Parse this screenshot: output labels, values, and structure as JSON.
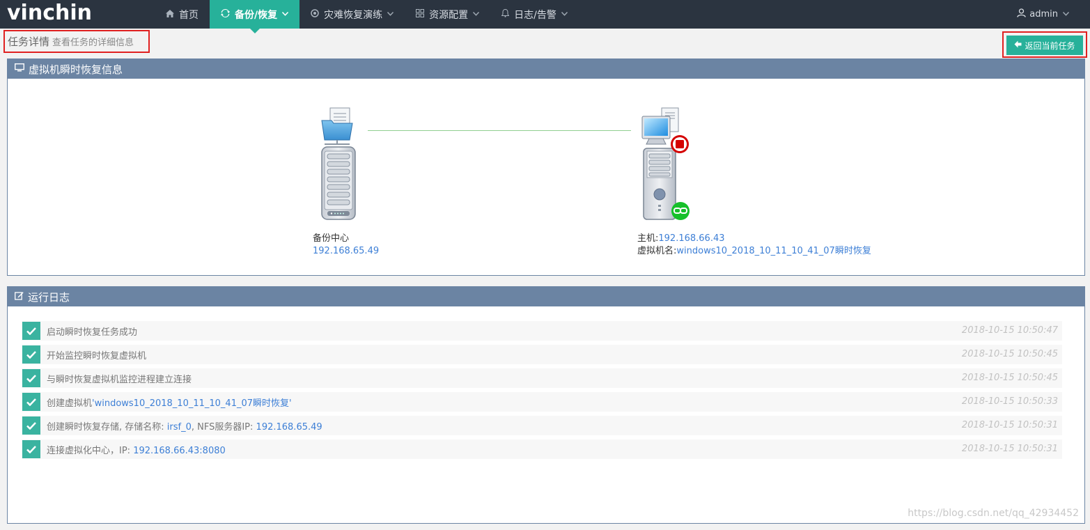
{
  "app": {
    "logo": "vinchin"
  },
  "nav": {
    "items": [
      {
        "label": "首页",
        "icon": "home-icon"
      },
      {
        "label": "备份/恢复",
        "icon": "sync-icon",
        "active": true
      },
      {
        "label": "灾难恢复演练",
        "icon": "drill-icon"
      },
      {
        "label": "资源配置",
        "icon": "grid-icon"
      },
      {
        "label": "日志/告警",
        "icon": "bell-icon"
      }
    ],
    "user": "admin"
  },
  "header": {
    "title": "任务详情",
    "subtitle": "查看任务的详细信息",
    "back_label": "返回当前任务"
  },
  "info_panel": {
    "title": "虚拟机瞬时恢复信息",
    "backup_center": {
      "label": "备份中心",
      "ip": "192.168.65.49"
    },
    "target": {
      "host_label": "主机:",
      "host_ip": "192.168.66.43",
      "vm_label": "虚拟机名:",
      "vm_name": "windows10_2018_10_11_10_41_07瞬时恢复"
    }
  },
  "log_panel": {
    "title": "运行日志",
    "entries": [
      {
        "text": "启动瞬时恢复任务成功",
        "time": "2018-10-15 10:50:47"
      },
      {
        "text": "开始监控瞬时恢复虚拟机",
        "time": "2018-10-15 10:50:45"
      },
      {
        "text": "与瞬时恢复虚拟机监控进程建立连接",
        "time": "2018-10-15 10:50:45"
      },
      {
        "prefix": "创建虚拟机",
        "link": "'windows10_2018_10_11_10_41_07瞬时恢复'",
        "time": "2018-10-15 10:50:33"
      },
      {
        "prefix": "创建瞬时恢复存储, 存储名称: ",
        "link": "irsf_0",
        "middle": ", NFS服务器IP: ",
        "link2": "192.168.65.49",
        "time": "2018-10-15 10:50:31"
      },
      {
        "prefix": "连接虚拟化中心，IP: ",
        "link": "192.168.66.43:8080",
        "time": "2018-10-15 10:50:31"
      }
    ]
  },
  "watermark": "https://blog.csdn.net/qq_42934452",
  "colors": {
    "nav_bg": "#2b3440",
    "accent": "#27b19a",
    "panel_head": "#6b84a3",
    "link": "#3d7fd6",
    "highlight_box": "#e02020"
  }
}
